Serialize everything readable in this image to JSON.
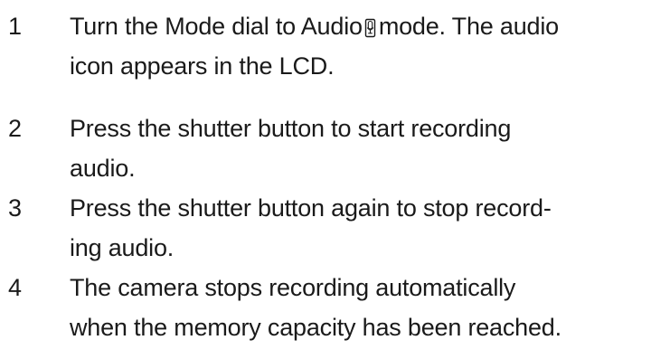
{
  "steps": [
    {
      "number": "1",
      "lines": [
        "Turn the Mode dial to Audio",
        "mode. The audio",
        "icon appears in the LCD."
      ],
      "icon": "audio-mode-icon"
    },
    {
      "number": "2",
      "lines": [
        "Press the shutter button to start recording",
        "audio."
      ]
    },
    {
      "number": "3",
      "lines": [
        "Press the shutter button again to stop record-",
        "ing audio."
      ]
    },
    {
      "number": "4",
      "lines": [
        "The camera stops recording automatically",
        "when the memory capacity has been reached."
      ]
    }
  ]
}
